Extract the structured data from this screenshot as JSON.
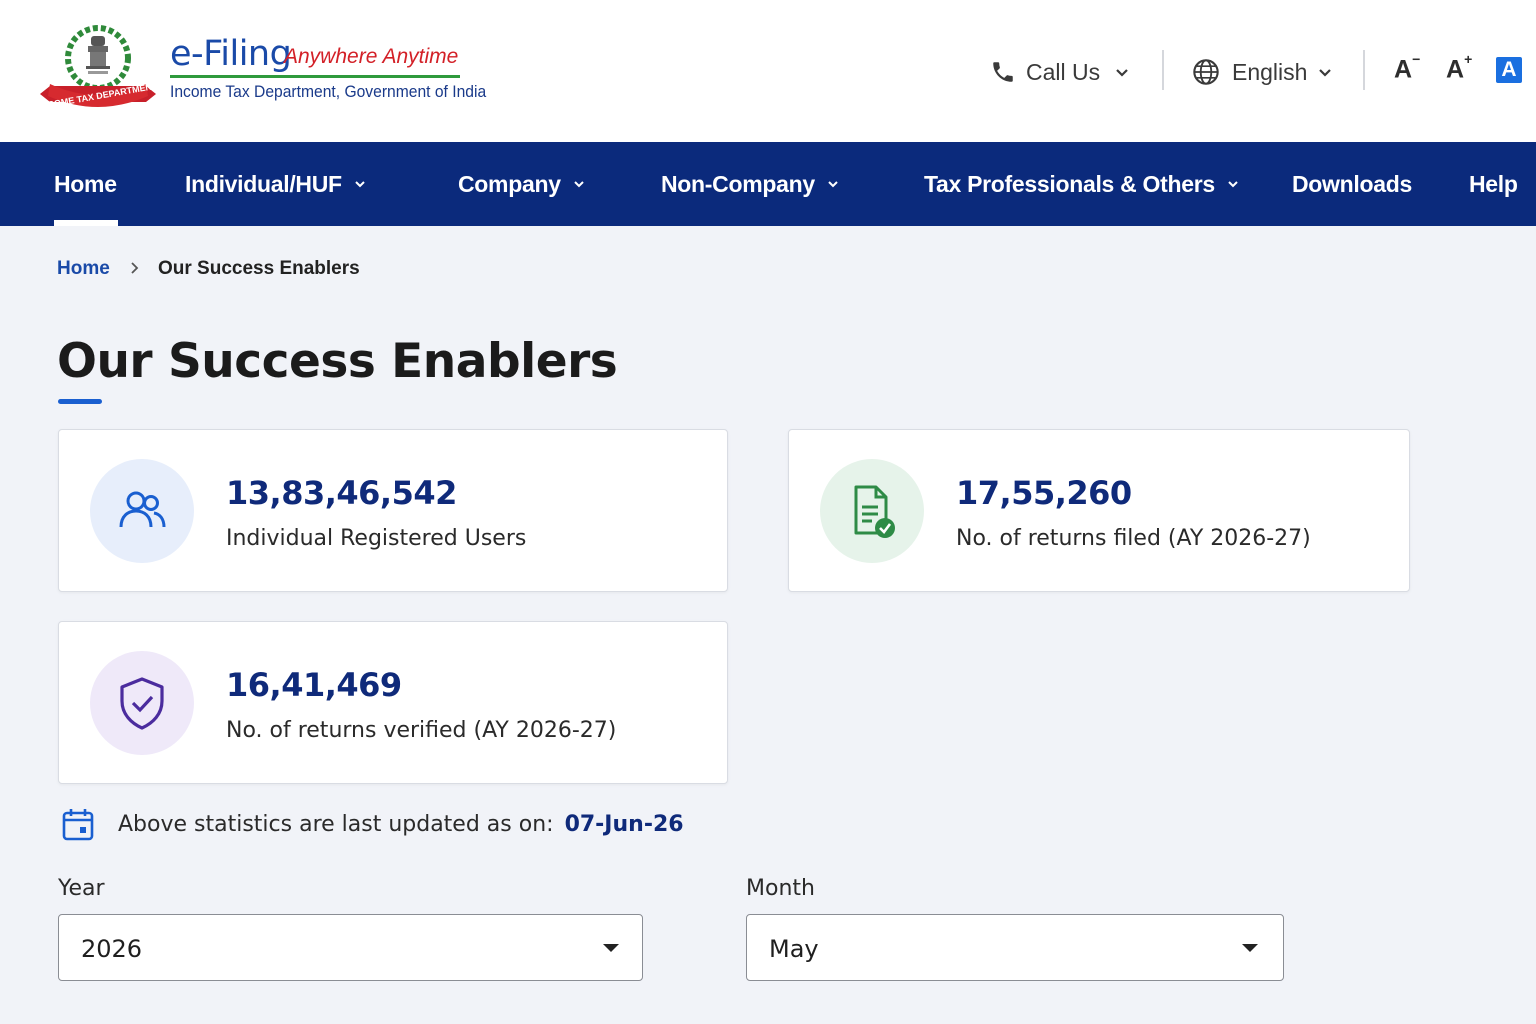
{
  "header": {
    "emblem_text": "INCOME TAX DEPARTMENT",
    "brand_title": "e-Filing",
    "brand_tagline": "Anywhere Anytime",
    "brand_subtitle": "Income Tax Department, Government of India",
    "call_us": "Call Us",
    "language": "English",
    "font_decrease": "A",
    "font_increase": "A",
    "font_default": "A"
  },
  "nav": {
    "items": [
      {
        "label": "Home"
      },
      {
        "label": "Individual/HUF"
      },
      {
        "label": "Company"
      },
      {
        "label": "Non-Company"
      },
      {
        "label": "Tax Professionals & Others"
      },
      {
        "label": "Downloads"
      },
      {
        "label": "Help"
      }
    ]
  },
  "breadcrumb": {
    "home": "Home",
    "current": "Our Success Enablers"
  },
  "page": {
    "title": "Our Success Enablers"
  },
  "stats": [
    {
      "value": "13,83,46,542",
      "label": "Individual Registered Users",
      "icon": "users-icon"
    },
    {
      "value": "17,55,260",
      "label": "No. of returns filed (AY 2026-27)",
      "icon": "document-check-icon"
    },
    {
      "value": "16,41,469",
      "label": "No. of returns verified (AY 2026-27)",
      "icon": "shield-check-icon"
    }
  ],
  "updated": {
    "text": "Above statistics are last updated as on:",
    "date": "07-Jun-26"
  },
  "filters": {
    "year_label": "Year",
    "year_value": "2026",
    "month_label": "Month",
    "month_value": "May"
  },
  "colors": {
    "nav_bg": "#0b2a7c",
    "accent_blue": "#1a5fd0",
    "value_navy": "#0f2a7a",
    "brand_red": "#d32027",
    "brand_green": "#2f9a3c"
  }
}
